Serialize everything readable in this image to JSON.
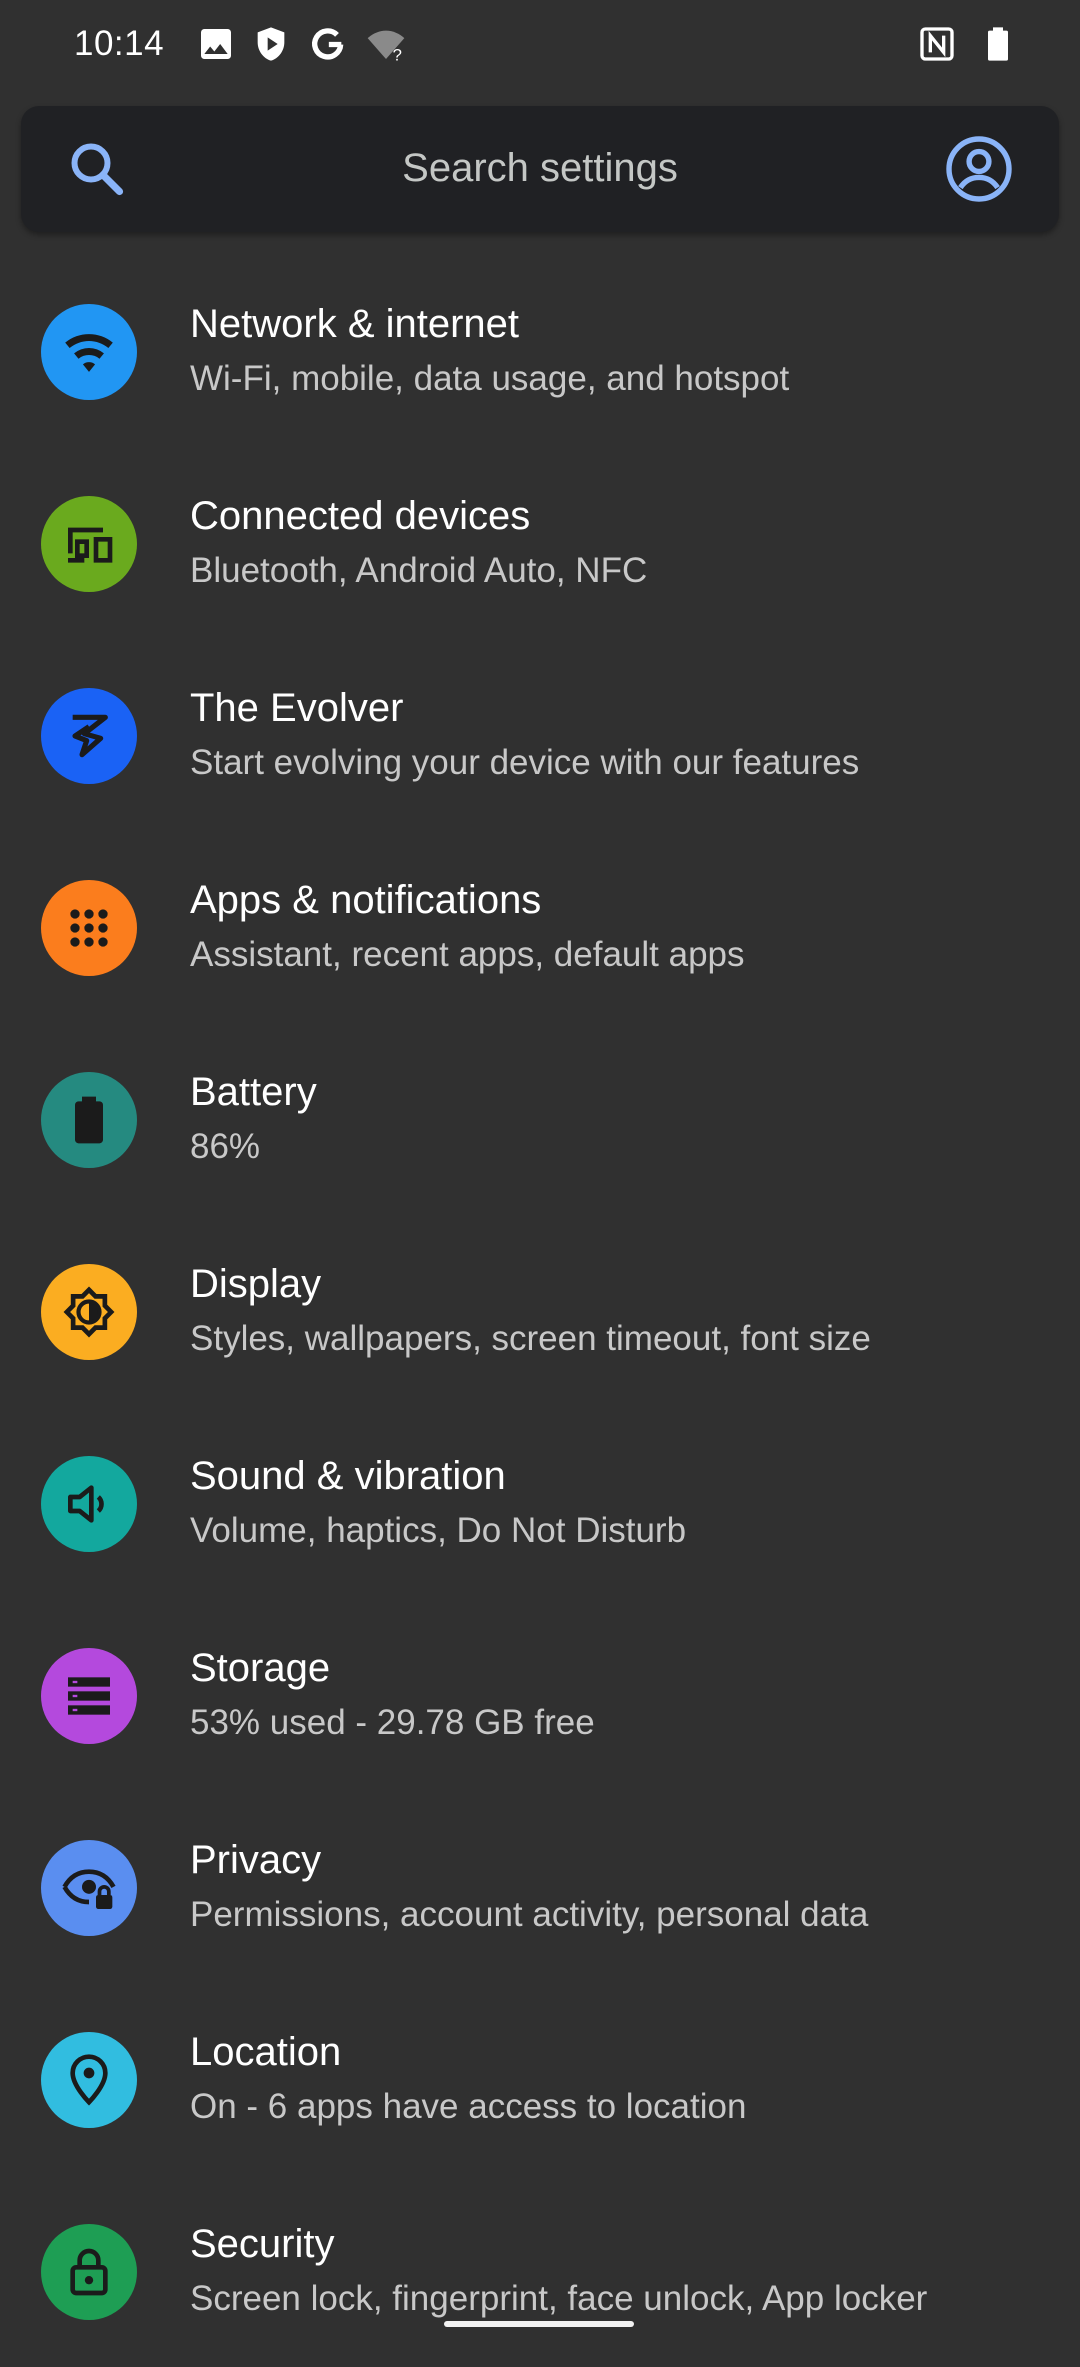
{
  "status_bar": {
    "time": "10:14",
    "left_icons": [
      "image-icon",
      "shield-icon",
      "google-g-icon",
      "wifi-unknown-icon"
    ],
    "right_icons": [
      "nfc-icon",
      "battery-icon"
    ]
  },
  "search": {
    "placeholder": "Search settings"
  },
  "items": [
    {
      "title": "Network & internet",
      "summary": "Wi-Fi, mobile, data usage, and hotspot",
      "icon": "wifi-icon",
      "color": "#2196f3"
    },
    {
      "title": "Connected devices",
      "summary": "Bluetooth, Android Auto, NFC",
      "icon": "devices-icon",
      "color": "#6aaa1e"
    },
    {
      "title": "The Evolver",
      "summary": "Start evolving your device with our features",
      "icon": "evolver-icon",
      "color": "#1a62f5"
    },
    {
      "title": "Apps & notifications",
      "summary": "Assistant, recent apps, default apps",
      "icon": "apps-grid-icon",
      "color": "#fb7d1d"
    },
    {
      "title": "Battery",
      "summary": "86%",
      "icon": "battery-icon",
      "color": "#258a80"
    },
    {
      "title": "Display",
      "summary": "Styles, wallpapers, screen timeout, font size",
      "icon": "brightness-icon",
      "color": "#fbad21"
    },
    {
      "title": "Sound & vibration",
      "summary": "Volume, haptics, Do Not Disturb",
      "icon": "volume-icon",
      "color": "#13a89e"
    },
    {
      "title": "Storage",
      "summary": "53% used - 29.78 GB free",
      "icon": "storage-icon",
      "color": "#b449dd"
    },
    {
      "title": "Privacy",
      "summary": "Permissions, account activity, personal data",
      "icon": "privacy-eye-icon",
      "color": "#5a8ef0"
    },
    {
      "title": "Location",
      "summary": "On - 6 apps have access to location",
      "icon": "location-pin-icon",
      "color": "#31bde0"
    },
    {
      "title": "Security",
      "summary": "Screen lock, fingerprint, face unlock, App locker",
      "icon": "lock-icon",
      "color": "#1e9e54"
    }
  ],
  "colors": {
    "background": "#303030",
    "search_bar": "#202124",
    "accent": "#8ab4f8"
  }
}
